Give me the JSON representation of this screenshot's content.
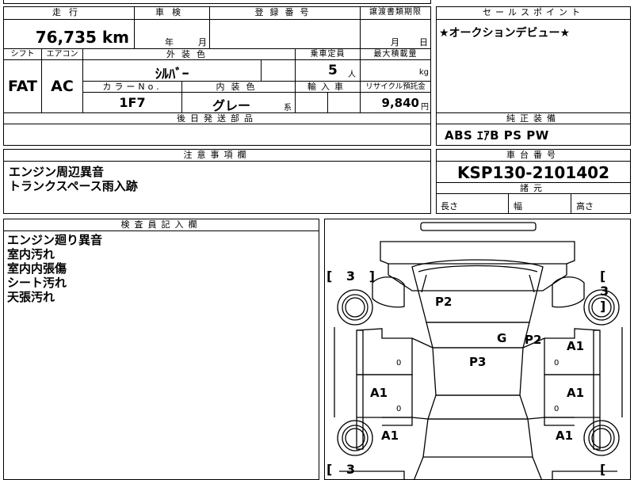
{
  "vehicle": {
    "mileage_label": "走行",
    "mileage": "76,735 km",
    "inspection_label": "車検",
    "inspection_year": "年",
    "inspection_month": "月",
    "registration_label": "登録番号",
    "transfer_label": "譲渡書類期限",
    "transfer_month": "月",
    "transfer_day": "日",
    "shift_label": "シフト",
    "shift": "FAT",
    "ac_label": "エアコン",
    "ac": "AC",
    "exterior_label": "外装色",
    "exterior_color": "ｼﾙﾊﾞｰ",
    "capacity_label": "乗車定員",
    "capacity": "5",
    "capacity_unit": "人",
    "load_label": "最大積載量",
    "load_unit": "kg",
    "color_no_label": "カラーNo.",
    "color_no": "1F7",
    "interior_label": "内装色",
    "interior_color": "グレー",
    "interior_suffix": "系",
    "import_label": "輸入車",
    "recycle_label": "リサイクル預託金",
    "recycle_fee": "9,840",
    "recycle_unit": "円",
    "later_parts_label": "後日発送部品"
  },
  "selling_points": {
    "label": "セールスポイント",
    "text": "★オークションデビュー★"
  },
  "equipment": {
    "label": "純正装備",
    "text": "ABS ｴｱB PS PW"
  },
  "cautions": {
    "label": "注意事項欄",
    "lines": [
      "エンジン周辺異音",
      "トランクスペース雨入跡"
    ]
  },
  "chassis": {
    "label": "車台番号",
    "number": "KSP130-2101402"
  },
  "dimensions": {
    "label": "諸元",
    "length": "長さ",
    "width": "幅",
    "height": "高さ"
  },
  "inspector": {
    "label": "検査員記入欄",
    "lines": [
      "エンジン廻り異音",
      "室内汚れ",
      "室内内張傷",
      "シート汚れ",
      "天張汚れ"
    ]
  },
  "diagram": {
    "bracket_tl": "[ 3 ]",
    "bracket_tr": "[ 3 ]",
    "bracket_bl": "[ 3",
    "bracket_br": "[ 3",
    "marks": {
      "hood": "P2",
      "glass": "G",
      "roof_right": "P2",
      "roof": "P3",
      "right_front": "A1",
      "left_mid": "A1",
      "right_mid": "A1",
      "left_rear": "A1",
      "right_rear": "A1"
    },
    "zeros": [
      "0",
      "0",
      "0",
      "0"
    ]
  }
}
